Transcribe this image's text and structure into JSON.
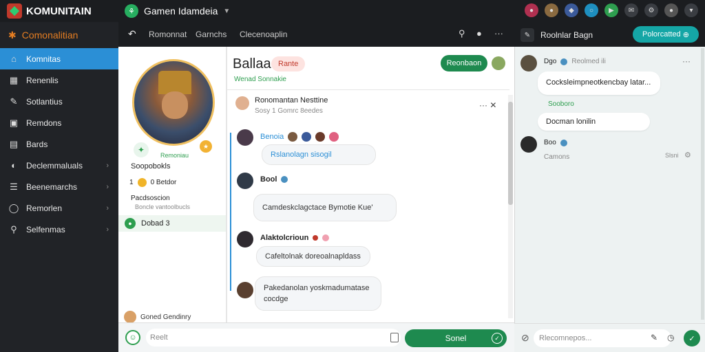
{
  "app": {
    "name": "KOMUNITAIN"
  },
  "channel": {
    "title": "Gamen Idamdeia"
  },
  "sidebar": {
    "header": "Comonalitian",
    "items": [
      {
        "label": "Komnitas",
        "icon": "home-icon"
      },
      {
        "label": "Renenlis",
        "icon": "grid-icon"
      },
      {
        "label": "Sotlantius",
        "icon": "pencil-icon"
      },
      {
        "label": "Remdons",
        "icon": "square-icon"
      },
      {
        "label": "Bards",
        "icon": "board-icon"
      },
      {
        "label": "Declemmaluals",
        "icon": "globe-icon"
      },
      {
        "label": "Beenemarchs",
        "icon": "chat-icon"
      },
      {
        "label": "Remorlen",
        "icon": "bubble-icon"
      },
      {
        "label": "Selfenmas",
        "icon": "search-icon"
      }
    ]
  },
  "subheader": {
    "tab1": "Romonnat",
    "tab2": "Garnchs",
    "tab3": "Clecenoaplin"
  },
  "profile": {
    "green_label": "Remoniau",
    "name": "Soopobokls",
    "count": "1",
    "stat": "0 Betdor",
    "detail": "Pacdsoscion",
    "detail_sub": "Boncle vantoolbucls",
    "active_label": "Dobad 3",
    "footer": "Goned Gendinry"
  },
  "feed": {
    "title": "Ballaa",
    "pill": "Rante",
    "sub": "Wenad Sonnakie",
    "follow_button": "Reonbaon",
    "post_author": "Ronomantan Nesttine",
    "post_meta": "Sosy 1 Gomrc 8eedes",
    "messages": [
      {
        "name": "Benoia",
        "text": "Rslanolagn sisogil"
      },
      {
        "name": "Bool",
        "text": "Camdeskclagctace Bymotie Kue'"
      },
      {
        "name": "Alaktolcrioun",
        "text": "Cafeltolnak doreoalnapldass"
      },
      {
        "name": "",
        "text": "Pakedanolan yoskmadumatase cocdge"
      }
    ]
  },
  "composer": {
    "placeholder": "Reelt",
    "send": "Sonel"
  },
  "right": {
    "title": "Roolnlar Bagn",
    "button": "Polorcatted",
    "messages": [
      {
        "name": "Dgo",
        "meta": "Reolmed ili",
        "text": "Cocksleimpneotkencbay latar..."
      },
      {
        "name": "",
        "meta": "Sooboro",
        "text": "Docman lonilin"
      },
      {
        "name": "Boo",
        "meta": "Camons",
        "time": "Slsni"
      }
    ],
    "placeholder": "Rlecomnepos..."
  },
  "colors": {
    "accent": "#1e8a4f",
    "sidebar_active": "#2b8fd6",
    "teal": "#15a6a6",
    "orange": "#e67e22"
  }
}
